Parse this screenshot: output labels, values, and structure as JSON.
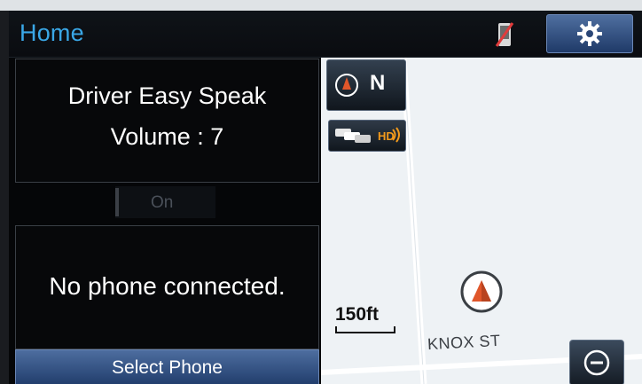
{
  "header": {
    "title": "Home",
    "phone_status_icon": "phone-disconnected-icon",
    "settings_icon": "gear-icon"
  },
  "voice": {
    "title": "Driver Easy Speak",
    "volume": "Volume : 7",
    "toggle_label": "On"
  },
  "phone": {
    "message": "No phone connected.",
    "select_label": "Select Phone"
  },
  "map": {
    "heading": "N",
    "scale": "150ft",
    "street": "KNOX ST",
    "traffic_icon": "traffic-hd-icon",
    "zoom_icon": "zoom-out-icon"
  },
  "colors": {
    "title_blue": "#3aa7e6",
    "button_blue": "#2f5288",
    "accent_orange": "#f29a1c",
    "vehicle_red": "#e0562a",
    "map_bg": "#eef2f5"
  }
}
